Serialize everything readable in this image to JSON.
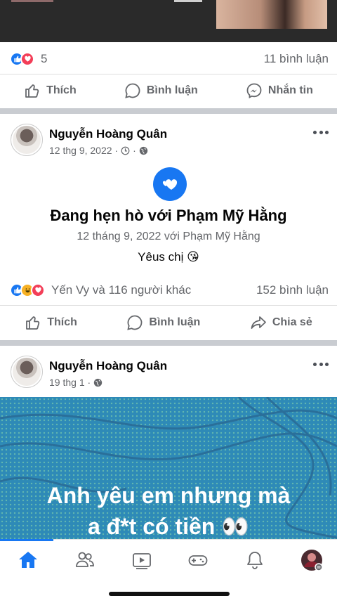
{
  "post1": {
    "reaction_count": "5",
    "comments": "11 bình luận",
    "actions": {
      "like": "Thích",
      "comment": "Bình luận",
      "message": "Nhắn tin"
    }
  },
  "post2": {
    "author": "Nguyễn Hoàng Quân",
    "date": "12 thg 9, 2022 ·",
    "event_title": "Đang hẹn hò với Phạm Mỹ Hằng",
    "event_sub": "12 tháng 9, 2022 với Phạm Mỹ Hằng",
    "caption": "Yêus chị 😘",
    "reactions_text": "Yến Vy và 116 người khác",
    "comments": "152 bình luận",
    "actions": {
      "like": "Thích",
      "comment": "Bình luận",
      "share": "Chia sẻ"
    }
  },
  "post3": {
    "author": "Nguyễn Hoàng Quân",
    "date": "19 thg 1 ·",
    "text_line1": "Anh yêu em nhưng mà",
    "text_line2": "a đ*t có tiền 👀"
  },
  "tabs": [
    "home-icon",
    "friends-icon",
    "watch-icon",
    "gaming-icon",
    "notifications-icon",
    "profile-avatar"
  ],
  "colors": {
    "accent": "#1877f2",
    "love": "#f33e58",
    "divider": "#c9ccd1",
    "bg_post": "#2e8ab7"
  }
}
